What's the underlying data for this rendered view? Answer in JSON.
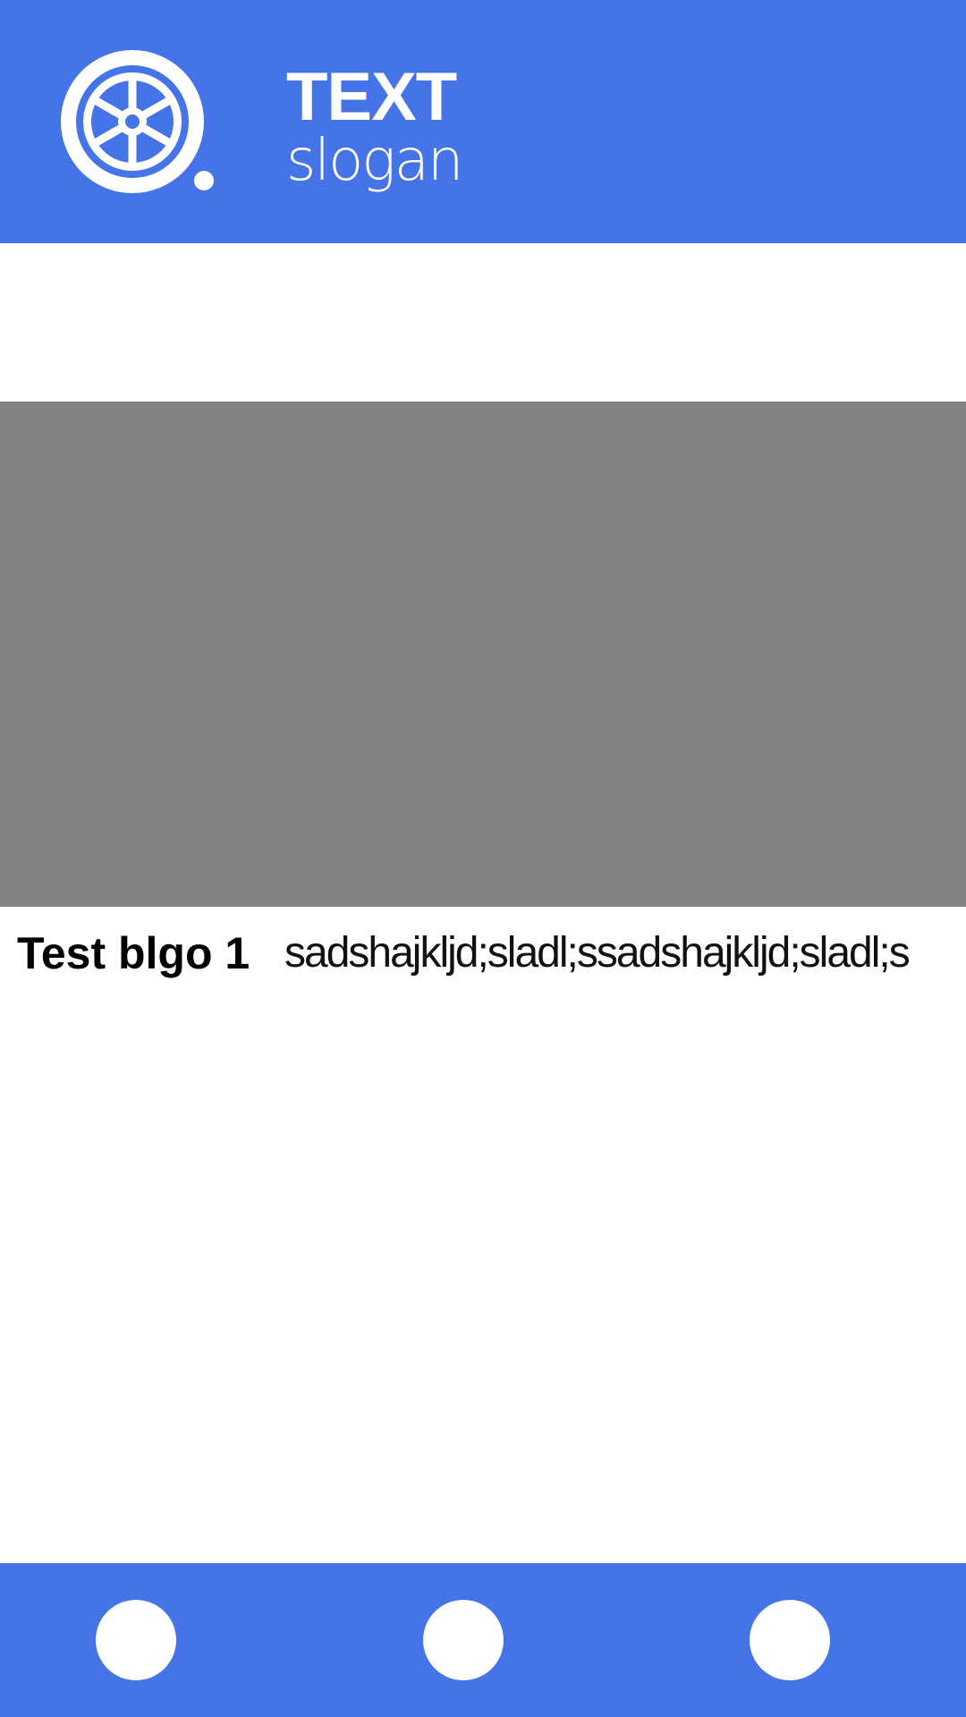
{
  "header": {
    "logo_icon": "wheel-icon",
    "title": "TEXT",
    "slogan": "slogan",
    "background_color": "#4474e8"
  },
  "hero": {
    "image_placeholder_color": "#838383"
  },
  "post": {
    "title": "Test blgo 1",
    "excerpt": "sadshajkljd;sladl;ssadshajkljd;sladl;s"
  },
  "bottom_nav": {
    "background_color": "#4474e8",
    "items": [
      {
        "icon": "circle-icon"
      },
      {
        "icon": "circle-icon"
      },
      {
        "icon": "circle-icon"
      }
    ]
  }
}
